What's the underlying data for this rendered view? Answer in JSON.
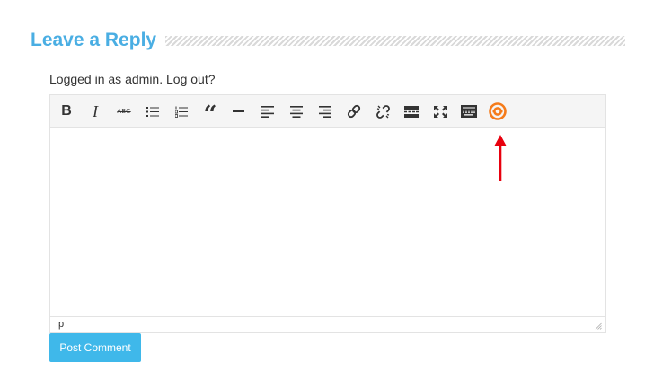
{
  "reply": {
    "title": "Leave a Reply"
  },
  "user": {
    "logged_in_prefix": "Logged in as ",
    "username": "admin",
    "dot": ".",
    "logout_label": "Log out?"
  },
  "editor": {
    "toolbar": [
      {
        "name": "bold-button",
        "icon": "bold-icon",
        "label": "B"
      },
      {
        "name": "italic-button",
        "icon": "italic-icon",
        "label": "I"
      },
      {
        "name": "strikethrough-button",
        "icon": "strikethrough-icon",
        "label": "ABC"
      },
      {
        "name": "bullet-list-button",
        "icon": "bullet-list-icon"
      },
      {
        "name": "numbered-list-button",
        "icon": "numbered-list-icon"
      },
      {
        "name": "blockquote-button",
        "icon": "quote-icon",
        "label": "“"
      },
      {
        "name": "horizontal-line-button",
        "icon": "horizontal-rule-icon"
      },
      {
        "name": "align-left-button",
        "icon": "align-left-icon"
      },
      {
        "name": "align-center-button",
        "icon": "align-center-icon"
      },
      {
        "name": "align-right-button",
        "icon": "align-right-icon"
      },
      {
        "name": "insert-link-button",
        "icon": "link-icon"
      },
      {
        "name": "remove-link-button",
        "icon": "unlink-icon"
      },
      {
        "name": "read-more-button",
        "icon": "read-more-icon"
      },
      {
        "name": "fullscreen-button",
        "icon": "fullscreen-icon"
      },
      {
        "name": "toolbar-toggle-button",
        "icon": "keyboard-icon"
      },
      {
        "name": "plugin-button",
        "icon": "lifebuoy-icon"
      }
    ],
    "path": "p"
  },
  "submit": {
    "label": "Post Comment"
  },
  "colors": {
    "accent": "#4aaee3",
    "button": "#3fb8ea",
    "plugin": "#f57b1a",
    "arrow": "#e8000e"
  }
}
